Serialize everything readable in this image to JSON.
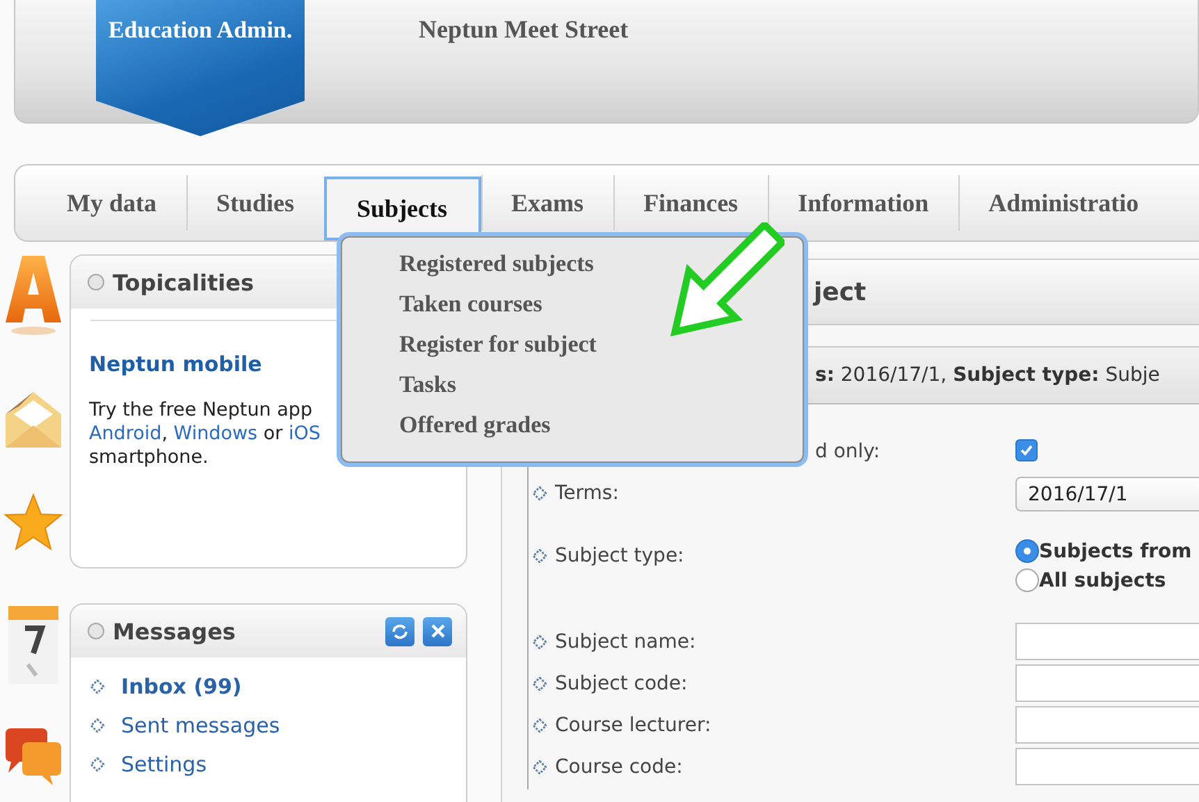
{
  "header": {
    "logo": "Education Admin.",
    "title": "Neptun Meet Street"
  },
  "tabs": [
    {
      "label": "My data",
      "selected": false
    },
    {
      "label": "Studies",
      "selected": false
    },
    {
      "label": "Subjects",
      "selected": true
    },
    {
      "label": "Exams",
      "selected": false
    },
    {
      "label": "Finances",
      "selected": false
    },
    {
      "label": "Information",
      "selected": false
    },
    {
      "label": "Administratio",
      "selected": false
    }
  ],
  "menu": {
    "items": [
      "Registered subjects",
      "Taken courses",
      "Register for subject",
      "Tasks",
      "Offered grades"
    ]
  },
  "topicalities": {
    "title": "Topicalities",
    "heading": "Neptun mobile",
    "text": [
      {
        "kind": "text",
        "text": "Try the free Neptun app"
      },
      {
        "kind": "break"
      },
      {
        "kind": "link",
        "text": "Android"
      },
      {
        "kind": "text",
        "text": ", "
      },
      {
        "kind": "link",
        "text": "Windows"
      },
      {
        "kind": "text",
        "text": " or "
      },
      {
        "kind": "link",
        "text": "iOS"
      },
      {
        "kind": "break"
      },
      {
        "kind": "text",
        "text": "smartphone."
      }
    ]
  },
  "messages": {
    "title": "Messages",
    "items": [
      {
        "label": "Inbox (99)",
        "selected": true
      },
      {
        "label": "Sent messages",
        "selected": false
      },
      {
        "label": "Settings",
        "selected": false
      }
    ]
  },
  "main": {
    "title": "ject",
    "filter": "**s:** 2016/17/1, **Subject type:** Subje",
    "rows": [
      {
        "kind": "checkbox",
        "label": "d only:",
        "checked": true
      },
      {
        "kind": "select",
        "label": "Terms:",
        "value": "2016/17/1"
      },
      {
        "kind": "radio",
        "label": "Subject type:",
        "options": [
          {
            "label": "Subjects from",
            "selected": true
          },
          {
            "label": "All subjects",
            "selected": false
          }
        ]
      },
      {
        "kind": "text",
        "label": "Subject name:"
      },
      {
        "kind": "text",
        "label": "Subject code:"
      },
      {
        "kind": "text",
        "label": "Course lecturer:"
      },
      {
        "kind": "text",
        "label": "Course code:"
      }
    ]
  }
}
